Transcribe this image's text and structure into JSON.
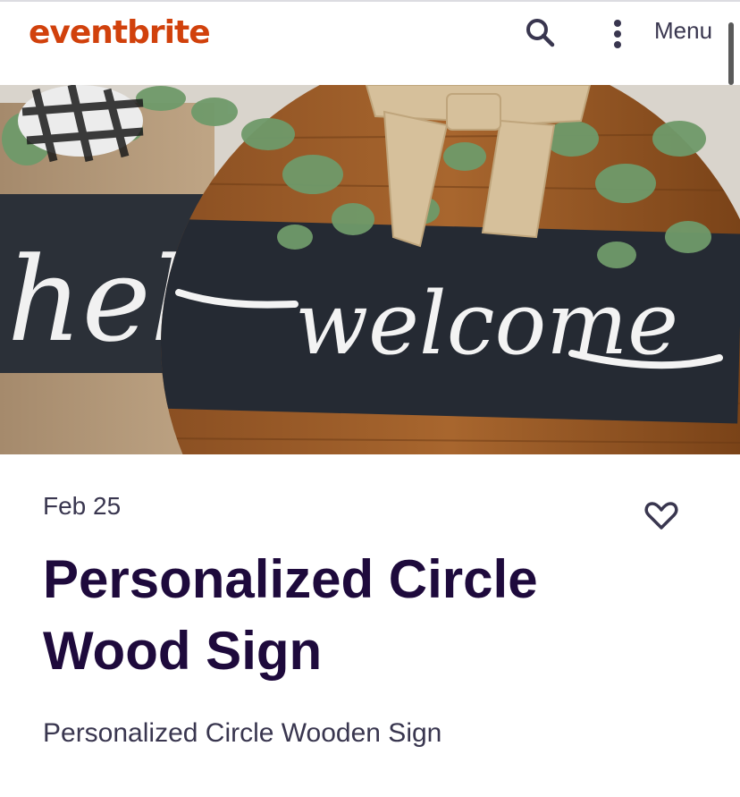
{
  "header": {
    "logo_text": "eventbrite",
    "menu_label": "Menu",
    "search_icon": "search-icon",
    "more_icon": "more-vertical-icon"
  },
  "hero_image": {
    "sign_text_left": "hel",
    "sign_text_main": "welcome",
    "icon": "hero-image"
  },
  "event": {
    "date": "Feb 25",
    "title": "Personalized Circle Wood Sign",
    "summary": "Personalized Circle Wooden Sign",
    "like_icon": "heart-outline-icon"
  },
  "colors": {
    "brand": "#d1410c",
    "title": "#1e0a3c",
    "text": "#39364f"
  }
}
